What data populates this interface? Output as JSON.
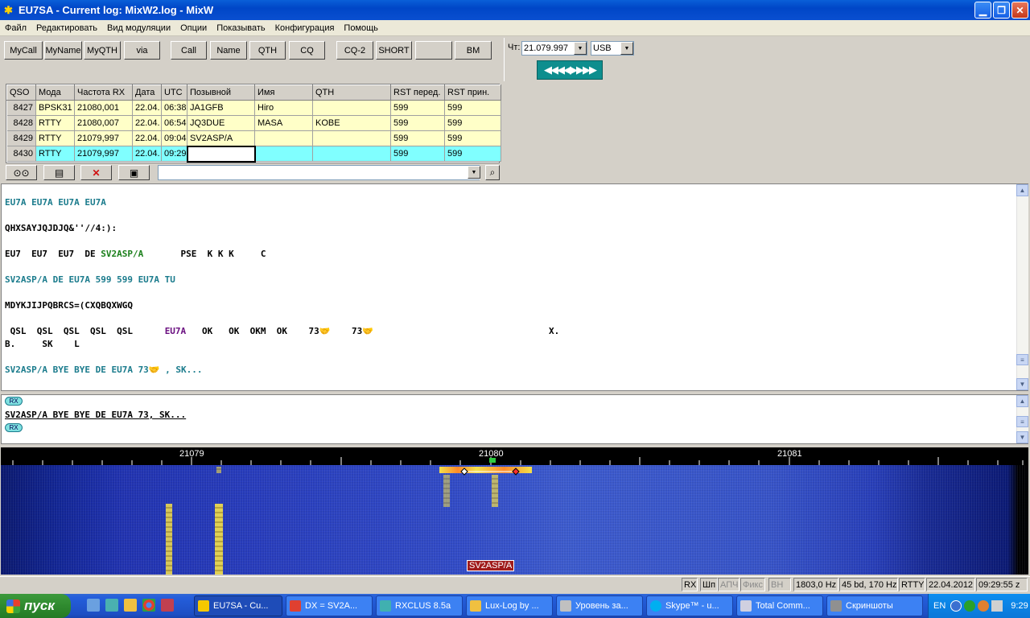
{
  "window": {
    "title": "EU7SA - Current log: MixW2.log - MixW"
  },
  "menu": [
    "Файл",
    "Редактировать",
    "Вид модуляции",
    "Опции",
    "Показывать",
    "Конфигурация",
    "Помощь"
  ],
  "macros": [
    "MyCall",
    "MyName",
    "MyQTH",
    "via",
    "Call",
    "Name",
    "QTH",
    "CQ",
    "CQ-2",
    "SHORT",
    "",
    "BM"
  ],
  "freq": {
    "label": "Чт:",
    "value": "21.079.997",
    "mode": "USB",
    "tune_glyphs": "◀◀◀◀▶▶▶▶"
  },
  "log": {
    "headers": [
      "QSO",
      "Мода",
      "Частота RX",
      "Дата",
      "UTC",
      "Позывной",
      "Имя",
      "QTH",
      "RST перед.",
      "RST прин."
    ],
    "rows": [
      [
        "8427",
        "BPSK31",
        "21080,001",
        "22.04.",
        "06:38",
        "JA1GFB",
        "Hiro",
        "",
        "599",
        "599"
      ],
      [
        "8428",
        "RTTY",
        "21080,007",
        "22.04.",
        "06:54",
        "JQ3DUE",
        "MASA",
        "KOBE",
        "599",
        "599"
      ],
      [
        "8429",
        "RTTY",
        "21079,997",
        "22.04.",
        "09:04",
        "SV2ASP/A",
        "",
        "",
        "599",
        "599"
      ],
      [
        "8430",
        "RTTY",
        "21079,997",
        "22.04.",
        "09:29",
        "",
        "",
        "",
        "599",
        "599"
      ]
    ]
  },
  "rx": {
    "l1": "EU7A EU7A EU7A EU7A",
    "l2": "QHXSAYJQJDJQ&''//4:):",
    "l3a": "EU7  EU7  EU7  DE ",
    "l3b": "SV2ASP/A",
    "l3c": "       PSE  K K K     C",
    "l4": "SV2ASP/A DE EU7A 599 599 EU7A TU",
    "l5": "MDYKJIJPQBRCS=(CXQBQXWGQ",
    "l6a": " QSL  QSL  QSL  QSL  QSL      ",
    "l6b": "EU7A",
    "l6c": "   OK   OK  OKM  OK    73",
    "l6d": "73",
    "l6e": "X.",
    "l7": "B.     SK    L",
    "l8a": "SV2ASP/A BYE BYE DE EU7A 73",
    "l8b": " , SK..."
  },
  "tx": {
    "badge": "RX",
    "line": "SV2ASP/A BYE BYE DE EU7A 73, SK..."
  },
  "scale": {
    "labels": [
      "21079",
      "21080",
      "21081"
    ]
  },
  "waterfall": {
    "label": "SV2ASP/A"
  },
  "status": [
    "RX",
    "Шп",
    "АПЧ",
    "Фикс",
    "ВН",
    "1803,0 Hz",
    "45 bd, 170 Hz",
    "RTTY",
    "22.04.2012",
    "09:29:55 z"
  ],
  "taskbar": {
    "start": "пуск",
    "tasks": [
      "EU7SA - Cu...",
      "DX = SV2A...",
      "RXCLUS 8.5a",
      "Lux-Log by ...",
      "Уровень за...",
      "Skype™ - u...",
      "Total Comm...",
      "Скриншоты"
    ],
    "lang": "EN",
    "clock": "9:29"
  },
  "colors": {
    "accent": "#0046c7",
    "log_old": "#ffffc8",
    "log_current": "#80ffff",
    "rx_teal": "#1a7b8c"
  }
}
